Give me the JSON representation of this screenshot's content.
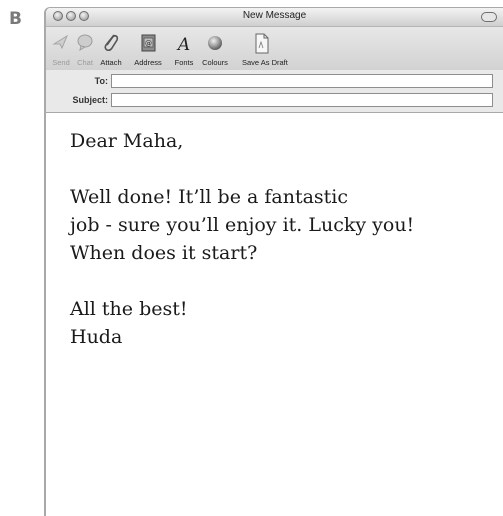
{
  "figure_label": "B",
  "window": {
    "title": "New Message"
  },
  "toolbar": {
    "send_label": "Send",
    "chat_label": "Chat",
    "attach_label": "Attach",
    "address_label": "Address",
    "fonts_label": "Fonts",
    "colours_label": "Colours",
    "draft_label": "Save As Draft",
    "fonts_glyph": "A"
  },
  "fields": {
    "to_label": "To:",
    "to_value": "",
    "subject_label": "Subject:",
    "subject_value": ""
  },
  "message": {
    "greeting": "Dear Maha,",
    "line1": "Well done! It’ll be a fantastic",
    "line2": "job - sure you’ll enjoy it. Lucky you!",
    "line3": "When does it start?",
    "closing": "All the best!",
    "signature": "Huda"
  },
  "icons": [
    "send-icon",
    "chat-icon",
    "paperclip-icon",
    "address-book-icon",
    "fonts-icon",
    "colours-icon",
    "draft-document-icon"
  ]
}
